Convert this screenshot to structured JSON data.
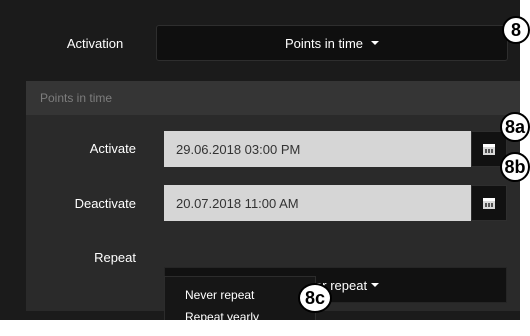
{
  "activation": {
    "label": "Activation",
    "value": "Points in time"
  },
  "panel": {
    "title": "Points in time",
    "activate": {
      "label": "Activate",
      "value": "29.06.2018 03:00 PM",
      "calendar_icon": "calendar-icon"
    },
    "deactivate": {
      "label": "Deactivate",
      "value": "20.07.2018 11:00 AM",
      "calendar_icon": "calendar-icon"
    },
    "repeat": {
      "label": "Repeat",
      "value": "Never repeat",
      "options": [
        "Never repeat",
        "Repeat yearly"
      ]
    }
  },
  "callouts": {
    "c8": "8",
    "c8a": "8a",
    "c8b": "8b",
    "c8c": "8c"
  },
  "colors": {
    "background": "#1b1b1b",
    "panel": "#2a2a2a",
    "input": "#d6d6d6",
    "button": "#0f0f0f"
  }
}
